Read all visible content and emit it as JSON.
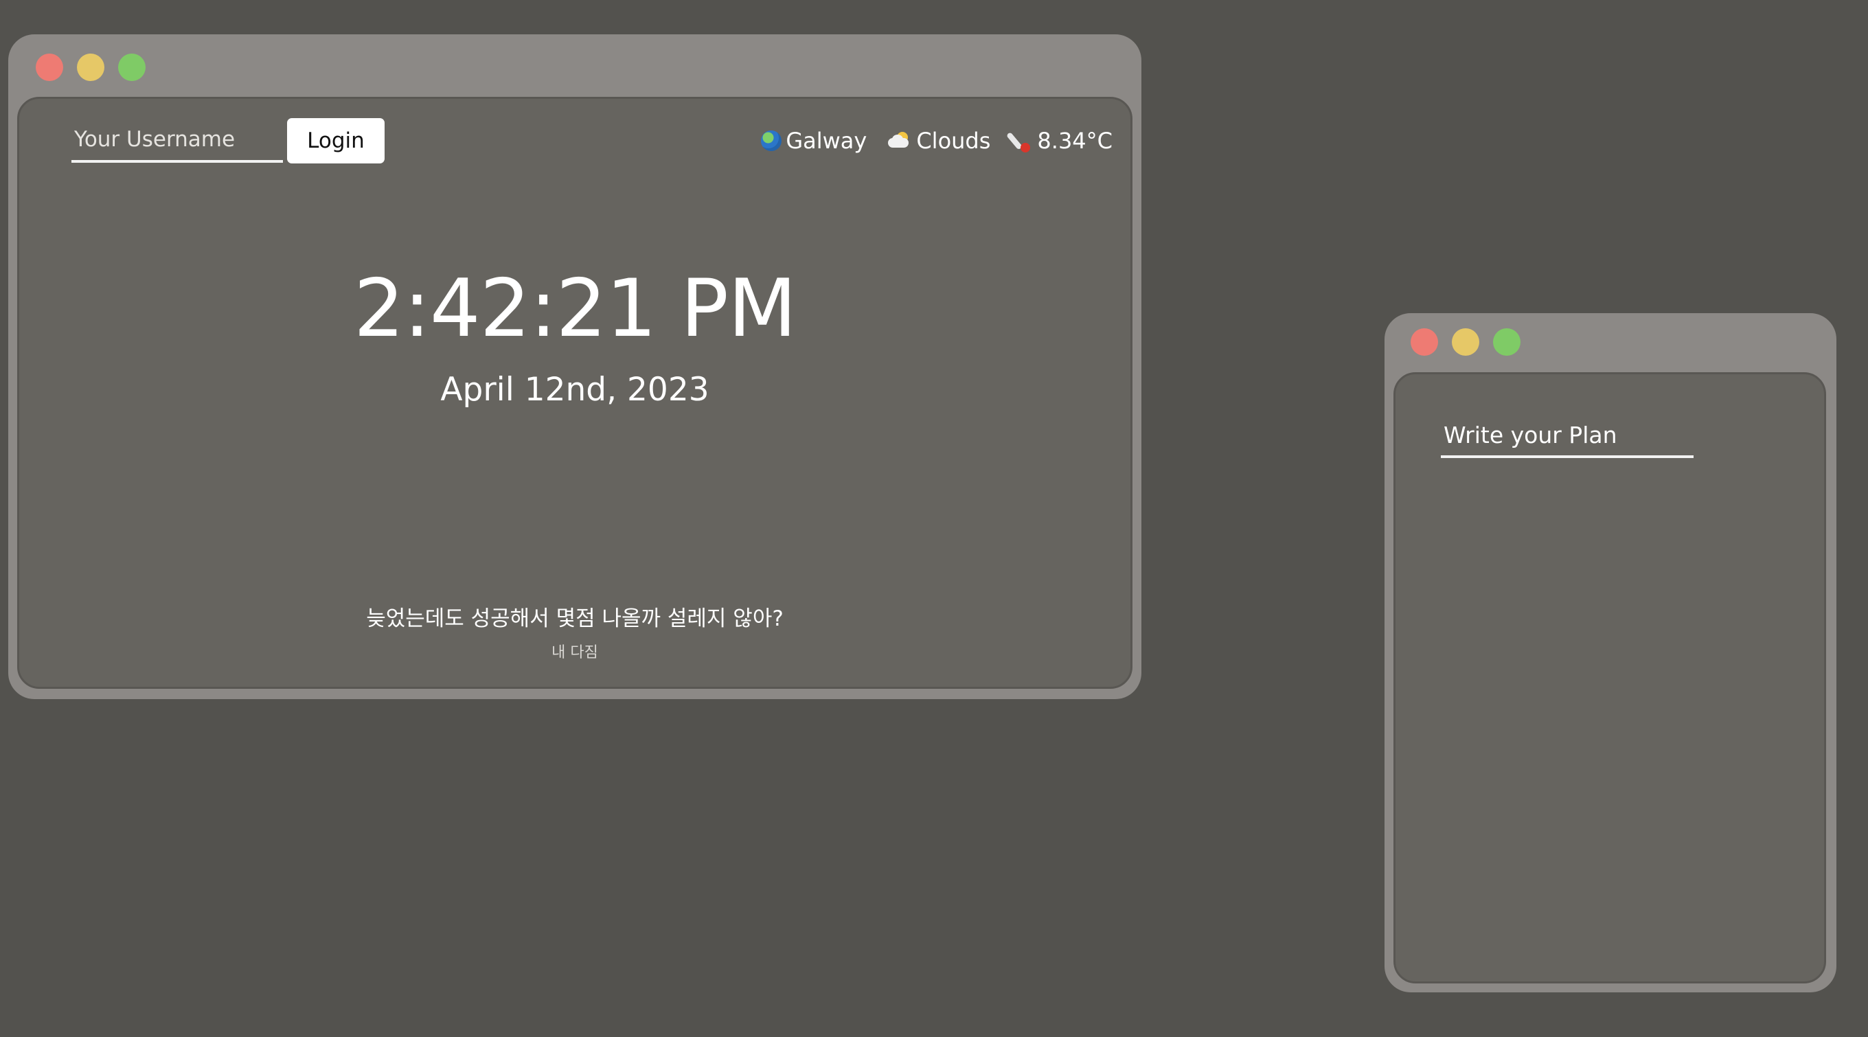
{
  "login": {
    "username_placeholder": "Your Username",
    "button_label": "Login"
  },
  "weather": {
    "city": "Galway",
    "condition": "Clouds",
    "temperature": "8.34°C",
    "city_icon": "globe-icon",
    "condition_icon": "sun-behind-cloud-icon",
    "temperature_icon": "thermometer-icon"
  },
  "clock": {
    "time": "2:42:21 PM",
    "date": "April 12nd, 2023"
  },
  "quote": {
    "text": "늦었는데도 성공해서 몇점 나올까 설레지 않아?",
    "author": "내 다짐"
  },
  "plan": {
    "input_placeholder": "Write your Plan"
  },
  "colors": {
    "desktop_background": "#53524e",
    "window_frame": "#8c8986",
    "window_content": "#66645f",
    "traffic_red": "#ee7b73",
    "traffic_yellow": "#e6c867",
    "traffic_green": "#7fcb66"
  }
}
